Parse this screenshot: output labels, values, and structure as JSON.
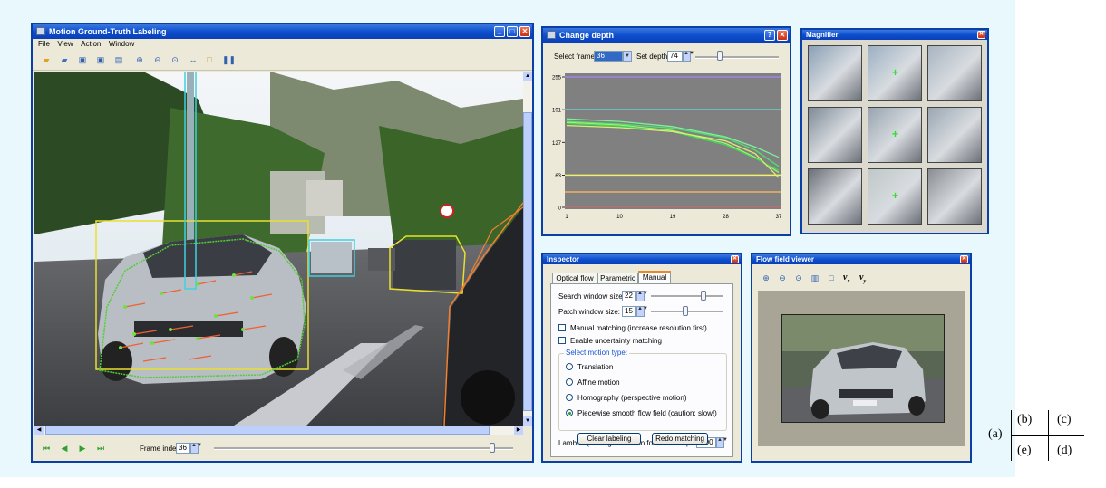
{
  "main_window": {
    "title": "Motion Ground-Truth Labeling",
    "menu": [
      "File",
      "View",
      "Action",
      "Window"
    ],
    "toolbar_icons": [
      "open-folder-icon",
      "folder-icon",
      "import-icon",
      "export-icon",
      "save-icon",
      "zoom-in-icon",
      "zoom-out-icon",
      "zoom-fit-icon",
      "link-icon",
      "new-layer-icon",
      "footprints-icon"
    ],
    "frame_index_label": "Frame index:",
    "frame_index_value": "36",
    "frame_slider_fraction": 0.93,
    "nav_icons": [
      "first-frame-icon",
      "prev-frame-icon",
      "next-frame-icon",
      "last-frame-icon"
    ]
  },
  "change_depth": {
    "title": "Change depth",
    "select_frame_label": "Select frame:",
    "select_frame_value": "36",
    "set_depth_label": "Set depth:",
    "set_depth_value": "74",
    "depth_slider_fraction": 0.29
  },
  "chart_data": {
    "type": "line",
    "x_ticks": [
      "1",
      "10",
      "19",
      "28",
      "37"
    ],
    "y_ticks": [
      "0",
      "63",
      "127",
      "191",
      "255"
    ],
    "xlim": [
      1,
      37
    ],
    "ylim": [
      0,
      255
    ],
    "flat_lines": [
      {
        "y": 255,
        "color": "#9f86e8"
      },
      {
        "y": 191,
        "color": "#5fe0e6"
      },
      {
        "y": 63,
        "color": "#eef070"
      },
      {
        "y": 30,
        "color": "#f0b060"
      },
      {
        "y": 2,
        "color": "#f06060"
      }
    ],
    "series": [
      {
        "color": "#7cf09a",
        "x": [
          1,
          10,
          19,
          28,
          33,
          37
        ],
        "values": [
          173,
          168,
          158,
          138,
          118,
          98
        ]
      },
      {
        "color": "#50e070",
        "x": [
          1,
          10,
          19,
          28,
          33,
          37
        ],
        "values": [
          168,
          163,
          155,
          136,
          112,
          80
        ]
      },
      {
        "color": "#a8f070",
        "x": [
          1,
          10,
          19,
          28,
          33,
          37
        ],
        "values": [
          166,
          161,
          150,
          125,
          98,
          68
        ]
      },
      {
        "color": "#40d858",
        "x": [
          1,
          10,
          19,
          28,
          33,
          37
        ],
        "values": [
          164,
          159,
          148,
          122,
          96,
          72
        ]
      },
      {
        "color": "#d8f070",
        "x": [
          1,
          10,
          19,
          28,
          33,
          37
        ],
        "values": [
          160,
          156,
          148,
          130,
          105,
          58
        ]
      }
    ]
  },
  "magnifier": {
    "title": "Magnifier"
  },
  "inspector": {
    "title": "Inspector",
    "tabs": [
      "Optical flow",
      "Parametric",
      "Manual"
    ],
    "active_tab": "Manual",
    "search_window_label": "Search window size:",
    "search_window_value": "22",
    "search_slider_fraction": 0.72,
    "patch_window_label": "Patch window size:",
    "patch_window_value": "15",
    "patch_slider_fraction": 0.47,
    "manual_matching_label": "Manual matching (increase resolution first)",
    "uncertainty_label": "Enable uncertainty matching",
    "motion_group_label": "Select motion type:",
    "motion_options": [
      "Translation",
      "Affine motion",
      "Homography (perspective motion)",
      "Piecewise smooth flow field (caution: slow!)"
    ],
    "selected_motion": 3,
    "lambda_label": "Lambda (the regularization for flow interpolation):",
    "lambda_value": "1.00",
    "clear_button": "Clear labeling",
    "redo_button": "Redo matching"
  },
  "flow_viewer": {
    "title": "Flow field viewer",
    "toolbar_icons": [
      "zoom-in-icon",
      "zoom-out-icon",
      "zoom-fit-icon",
      "copy-icon",
      "window-icon"
    ],
    "vx_label": "v",
    "vx_sub": "x",
    "vy_label": "v",
    "vy_sub": "y"
  },
  "figure_labels": {
    "a": "(a)",
    "b": "(b)",
    "c": "(c)",
    "d": "(d)",
    "e": "(e)"
  }
}
